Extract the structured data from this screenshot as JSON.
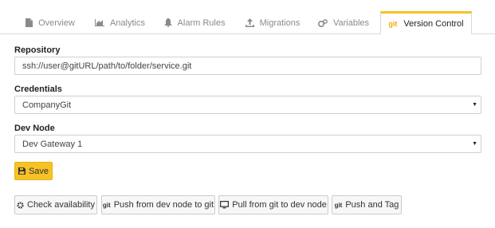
{
  "tabs": [
    {
      "label": "Overview",
      "icon": "file-icon"
    },
    {
      "label": "Analytics",
      "icon": "area-chart-icon"
    },
    {
      "label": "Alarm Rules",
      "icon": "bell-icon"
    },
    {
      "label": "Migrations",
      "icon": "upload-icon"
    },
    {
      "label": "Variables",
      "icon": "cogs-icon"
    },
    {
      "label": "Version Control",
      "icon": "git-icon",
      "icon_text": "git",
      "active": true
    }
  ],
  "form": {
    "repository": {
      "label": "Repository",
      "value": "ssh://user@gitURL/path/to/folder/service.git"
    },
    "credentials": {
      "label": "Credentials",
      "value": "CompanyGit"
    },
    "dev_node": {
      "label": "Dev Node",
      "value": "Dev Gateway 1"
    },
    "save_label": "Save"
  },
  "actions": {
    "check": "Check availability",
    "push_git": "Push from dev node to git",
    "pull_git": "Pull from git to dev node",
    "push_tag": "Push and Tag",
    "git_icon_text": "git"
  },
  "colors": {
    "accent": "#f6c226",
    "border": "#d0d0d0"
  }
}
